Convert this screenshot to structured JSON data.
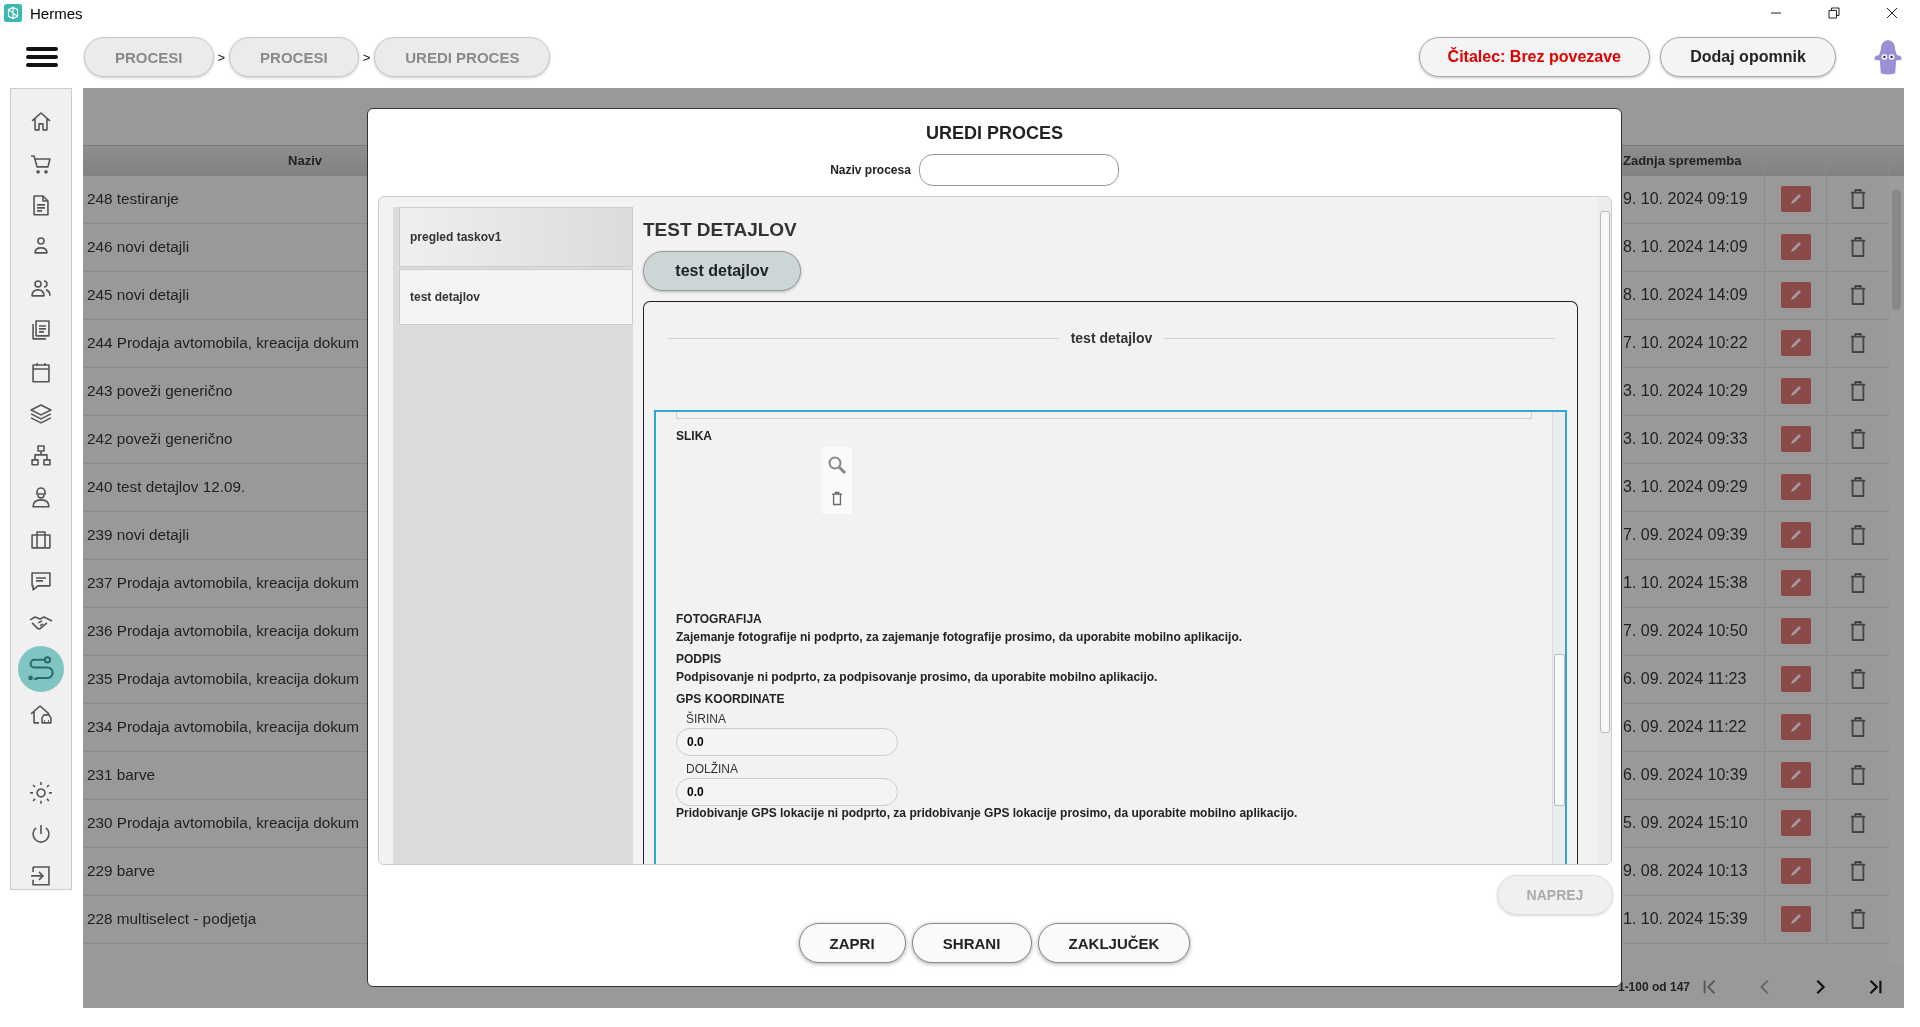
{
  "window": {
    "title": "Hermes"
  },
  "breadcrumbs": [
    "PROCESI",
    "PROCESI",
    "UREDI PROCES"
  ],
  "breadcrumb_separator": ">",
  "header_buttons": [
    {
      "label": "Čitalec: Brez povezave",
      "kind": "alert"
    },
    {
      "label": "Dodaj opomnik",
      "kind": "plain"
    }
  ],
  "sidebar": {
    "items": [
      {
        "selected": false
      },
      {
        "selected": false
      },
      {
        "selected": false
      },
      {
        "selected": false
      },
      {
        "selected": false
      },
      {
        "selected": false
      },
      {
        "selected": false
      },
      {
        "selected": false
      },
      {
        "selected": false
      },
      {
        "selected": false
      },
      {
        "selected": false
      },
      {
        "selected": false
      },
      {
        "selected": false
      },
      {
        "selected": true
      },
      {
        "selected": false
      }
    ],
    "bottom_items": [
      {
        "selected": false
      },
      {
        "selected": false
      },
      {
        "selected": false
      }
    ]
  },
  "table": {
    "columns": [
      "Naziv",
      "Zadnja sprememba"
    ],
    "rows": [
      {
        "name": "248 testiranje",
        "date": "9. 10. 2024 09:19"
      },
      {
        "name": "246 novi detajli",
        "date": "8. 10. 2024 14:09"
      },
      {
        "name": "245 novi detajli",
        "date": "8. 10. 2024 14:09"
      },
      {
        "name": "244 Prodaja avtomobila, kreacija dokum",
        "date": "7. 10. 2024 10:22"
      },
      {
        "name": "243 poveži generično",
        "date": "3. 10. 2024 10:29"
      },
      {
        "name": "242 poveži generično",
        "date": "3. 10. 2024 09:33"
      },
      {
        "name": "240 test detajlov 12.09.",
        "date": "3. 10. 2024 09:29"
      },
      {
        "name": "239 novi detajli",
        "date": "7. 09. 2024 09:39"
      },
      {
        "name": "237 Prodaja avtomobila, kreacija dokum",
        "date": "1. 10. 2024 15:38"
      },
      {
        "name": "236 Prodaja avtomobila, kreacija dokum",
        "date": "7. 09. 2024 10:50"
      },
      {
        "name": "235 Prodaja avtomobila, kreacija dokum",
        "date": "6. 09. 2024 11:23"
      },
      {
        "name": "234 Prodaja avtomobila, kreacija dokum",
        "date": "6. 09. 2024 11:22"
      },
      {
        "name": "231 barve",
        "date": "6. 09. 2024 10:39"
      },
      {
        "name": "230 Prodaja avtomobila, kreacija dokum",
        "date": "5. 09. 2024 15:10"
      },
      {
        "name": "229 barve",
        "date": "9. 08. 2024 10:13"
      },
      {
        "name": "228 multiselect - podjetja",
        "date": "1. 10. 2024 15:39"
      }
    ],
    "pager": "1-100 od 147"
  },
  "dialog": {
    "title": "UREDI PROCES",
    "name_label": "Naziv procesa",
    "tabs": [
      {
        "label": "pregled taskov1",
        "selected": false
      },
      {
        "label": "test detajlov",
        "selected": true
      }
    ],
    "section_title": "TEST DETAJLOV",
    "step_button": "test detajlov",
    "fieldset_legend": "test detajlov",
    "fields": [
      {
        "kind": "image",
        "label": "SLIKA"
      },
      {
        "kind": "note",
        "label": "FOTOGRAFIJA",
        "text": "Zajemanje fotografije ni podprto, za zajemanje fotografije prosimo, da uporabite mobilno aplikacijo."
      },
      {
        "kind": "note",
        "label": "PODPIS",
        "text": "Podpisovanje ni podprto, za podpisovanje prosimo, da uporabite mobilno aplikacijo."
      },
      {
        "kind": "gps",
        "label": "GPS KOORDINATE",
        "inputs": [
          {
            "label": "ŠIRINA",
            "value": "0.0"
          },
          {
            "label": "DOLŽINA",
            "value": "0.0"
          }
        ],
        "text": "Pridobivanje GPS lokacije ni podprto, za pridobivanje GPS lokacije prosimo, da uporabite mobilno aplikacijo."
      }
    ],
    "next_button": {
      "label": "NAPREJ",
      "disabled": true
    },
    "buttons": [
      "ZAPRI",
      "SHRANI",
      "ZAKLJUČEK"
    ]
  }
}
